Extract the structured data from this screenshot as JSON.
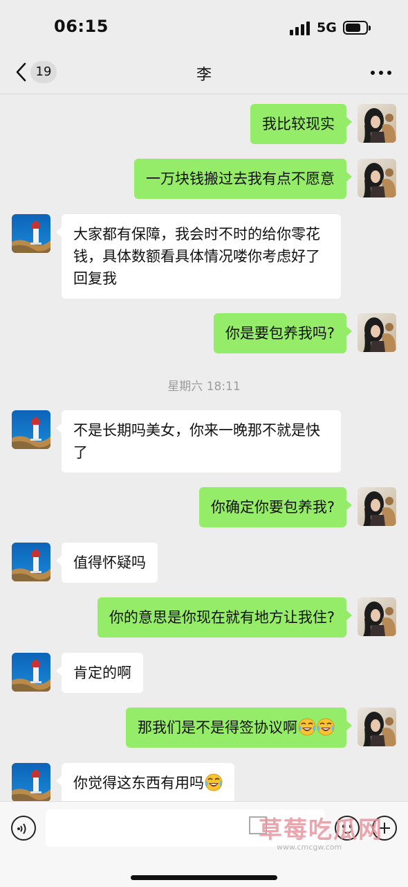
{
  "status_bar": {
    "time": "06:15",
    "network": "5G"
  },
  "nav": {
    "badge": "19",
    "title": "李"
  },
  "timestamp": "星期六 18:11",
  "messages": [
    {
      "side": "me",
      "text": "我比较现实"
    },
    {
      "side": "me",
      "text": "一万块钱搬过去我有点不愿意"
    },
    {
      "side": "them",
      "text": "大家都有保障，我会时不时的给你零花钱，具体数额看具体情况喽你考虑好了回复我"
    },
    {
      "side": "me",
      "text": "你是要包养我吗?"
    },
    {
      "side": "them",
      "text": "不是长期吗美女，你来一晚那不就是快了"
    },
    {
      "side": "me",
      "text": "你确定你要包养我?"
    },
    {
      "side": "them",
      "text": "值得怀疑吗"
    },
    {
      "side": "me",
      "text": "你的意思是你现在就有地方让我住?"
    },
    {
      "side": "them",
      "text": "肯定的啊"
    },
    {
      "side": "me",
      "text": "那我们是不是得签协议啊",
      "emojis": [
        "laughing-crying-emoji",
        "laughing-crying-emoji"
      ]
    },
    {
      "side": "them",
      "text": "你觉得这东西有用吗",
      "emojis": [
        "laughing-crying-emoji"
      ]
    }
  ],
  "input": {
    "placeholder": ""
  },
  "watermark": {
    "text": "草莓吃瓜网",
    "sub": "www.cmcgw.com"
  },
  "colors": {
    "background": "#ededed",
    "my_bubble": "#95ec69",
    "their_bubble": "#ffffff"
  },
  "icons": [
    "chevron-left-icon",
    "more-dots-icon",
    "voice-icon",
    "emoji-icon",
    "plus-icon"
  ]
}
